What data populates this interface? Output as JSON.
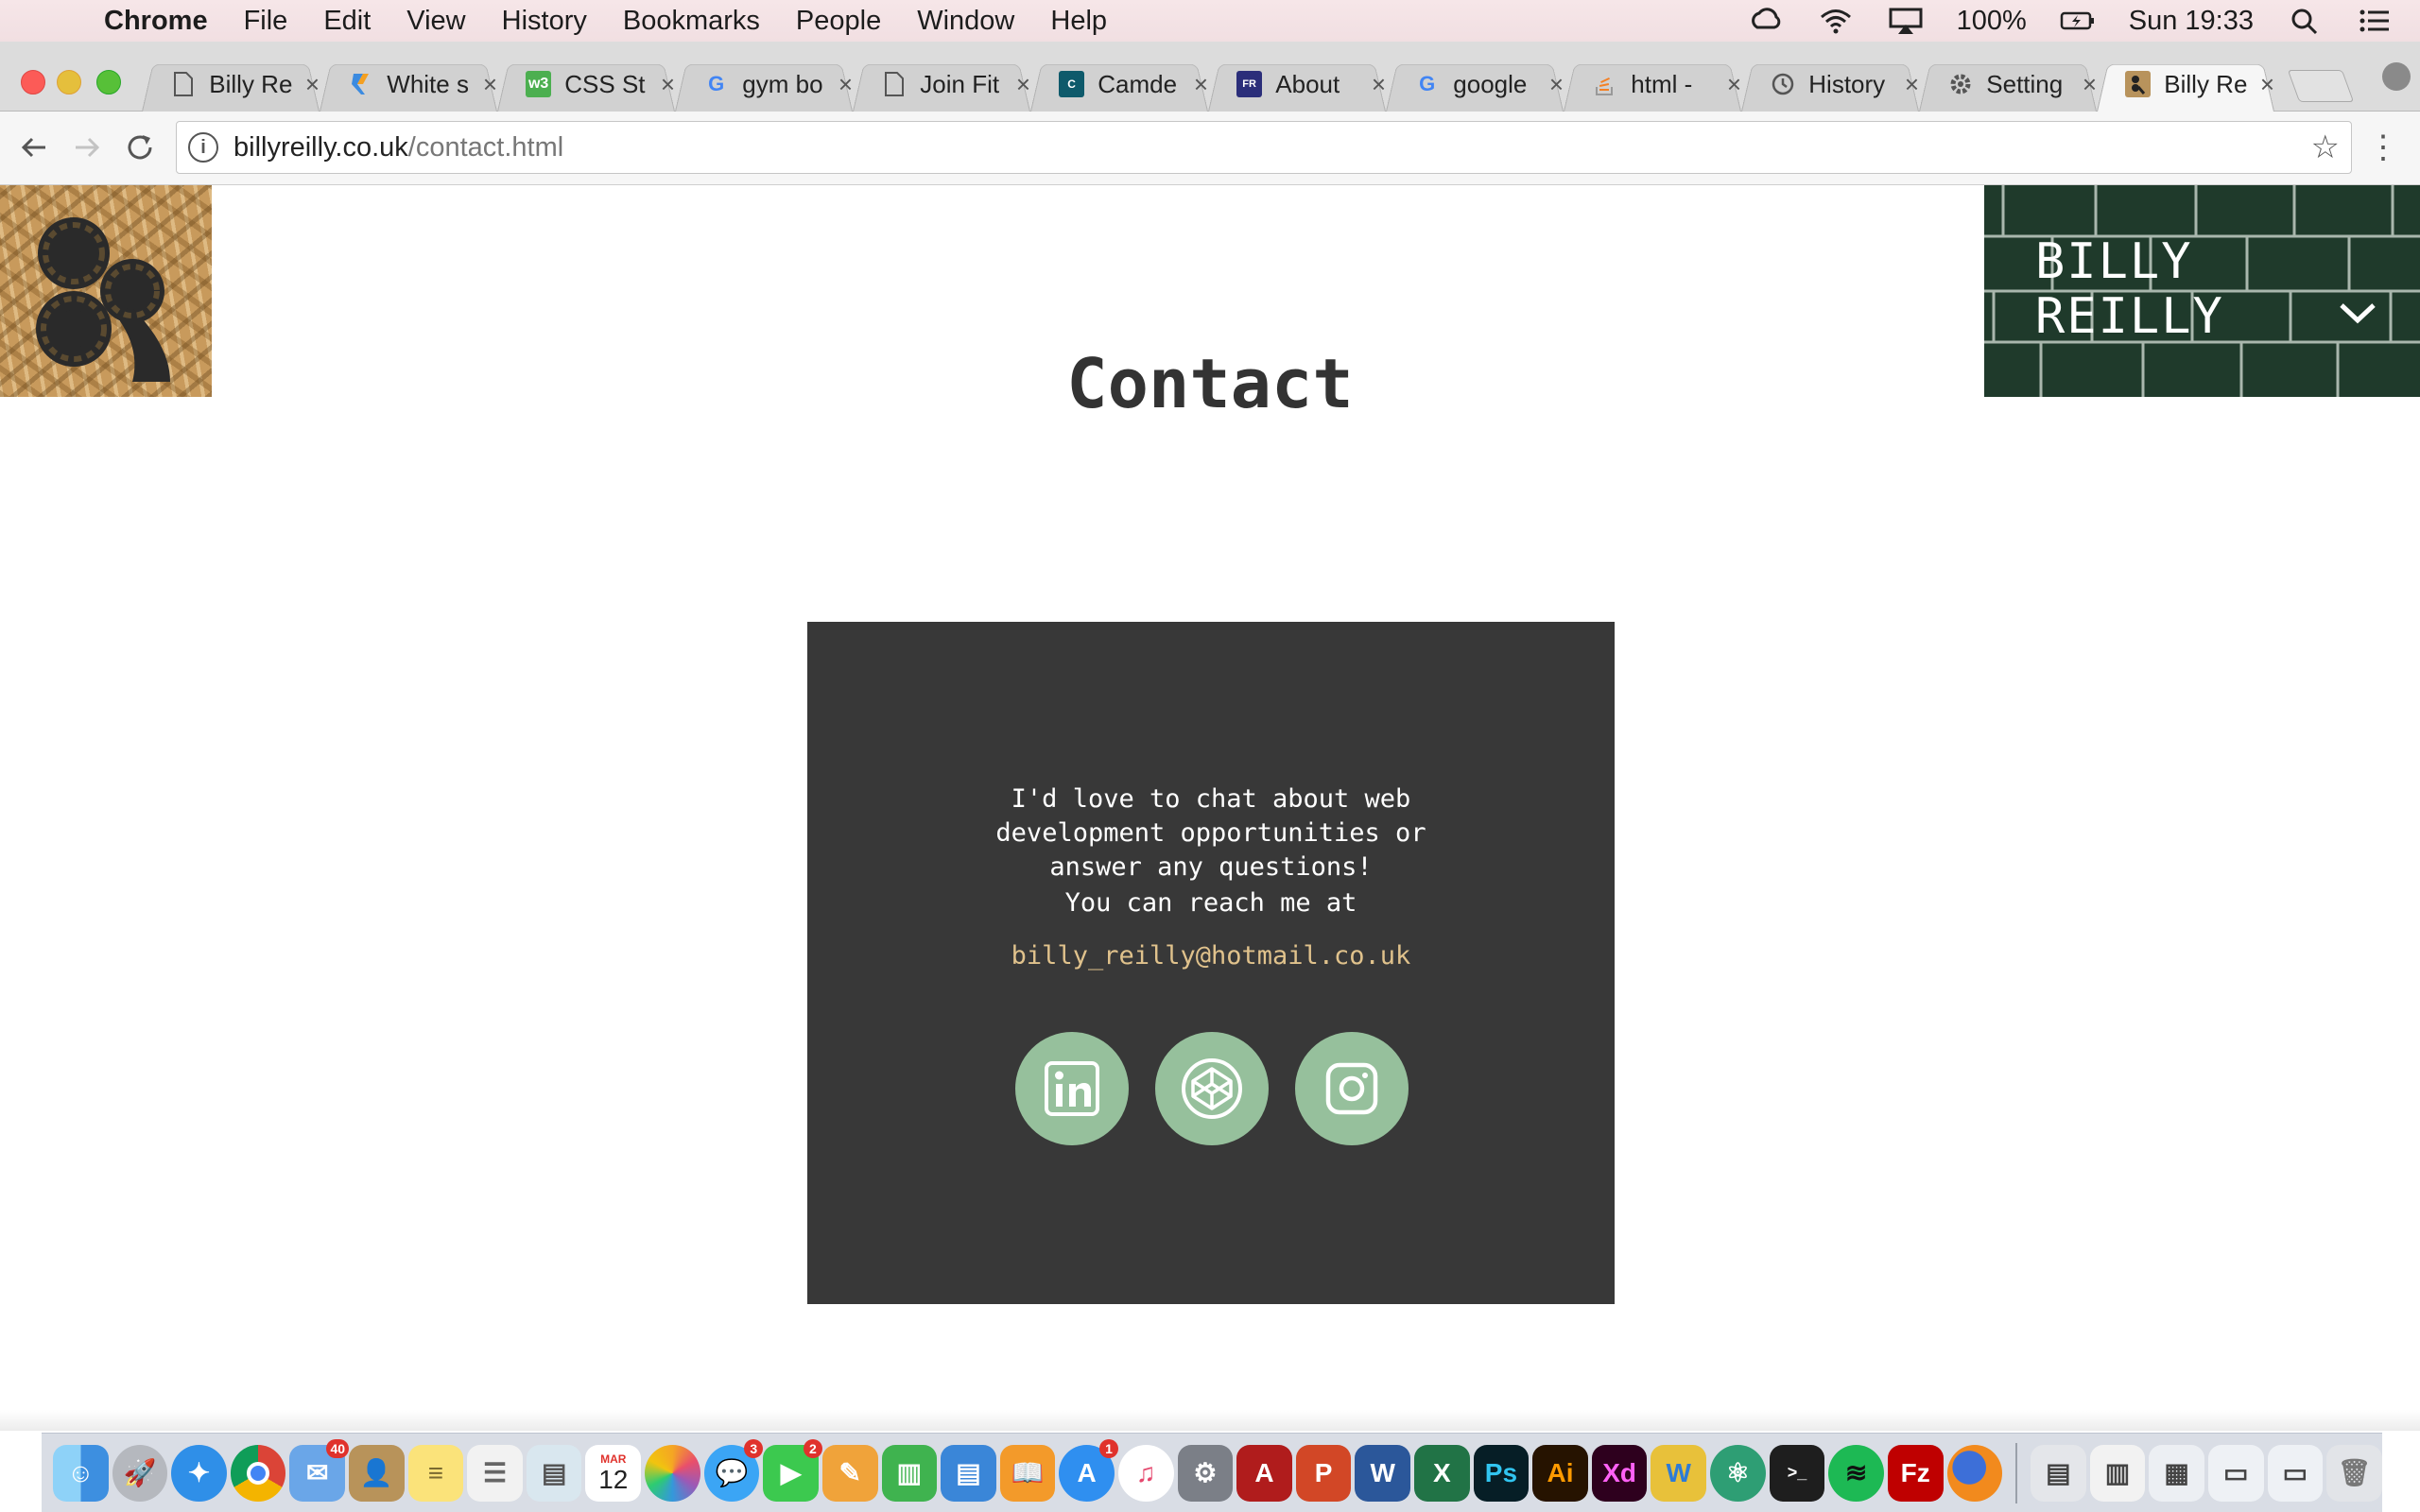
{
  "menubar": {
    "app_name": "Chrome",
    "items": [
      "File",
      "Edit",
      "View",
      "History",
      "Bookmarks",
      "People",
      "Window",
      "Help"
    ],
    "battery": "100%",
    "clock": "Sun 19:33"
  },
  "tabs": [
    {
      "title": "Billy Re",
      "icon": "page-icon"
    },
    {
      "title": "White s",
      "icon": "sketch-icon"
    },
    {
      "title": "CSS St",
      "icon": "w3-icon"
    },
    {
      "title": "gym bo",
      "icon": "google-icon"
    },
    {
      "title": "Join Fit",
      "icon": "page-icon"
    },
    {
      "title": "Camde",
      "icon": "camden-icon"
    },
    {
      "title": "About",
      "icon": "about-icon"
    },
    {
      "title": "google",
      "icon": "google-icon"
    },
    {
      "title": "html -",
      "icon": "stackoverflow-icon"
    },
    {
      "title": "History",
      "icon": "history-icon"
    },
    {
      "title": "Setting",
      "icon": "settings-icon"
    },
    {
      "title": "Billy Re",
      "icon": "billy-logo-icon"
    }
  ],
  "address": {
    "host": "billyreilly.co.uk",
    "path": "/contact.html"
  },
  "site": {
    "name_line1": "BILLY",
    "name_line2": "REILLY",
    "page_title": "Contact",
    "intro": "I'd love to chat about web development opportunities or answer any questions!",
    "reach": "You can reach me at",
    "email": "billy_reilly@hotmail.co.uk",
    "socials": [
      "linkedin-icon",
      "codepen-icon",
      "instagram-icon"
    ]
  },
  "dock": {
    "badges": {
      "mail": "40",
      "messages": "3",
      "facetime": "2",
      "appstore": "1",
      "calendar_month": "MAR",
      "calendar_day": "12"
    }
  },
  "colors": {
    "card_bg": "#383838",
    "email": "#e0c28c",
    "social_circle": "#96c09c",
    "name_panel": "#1f3a2b"
  }
}
